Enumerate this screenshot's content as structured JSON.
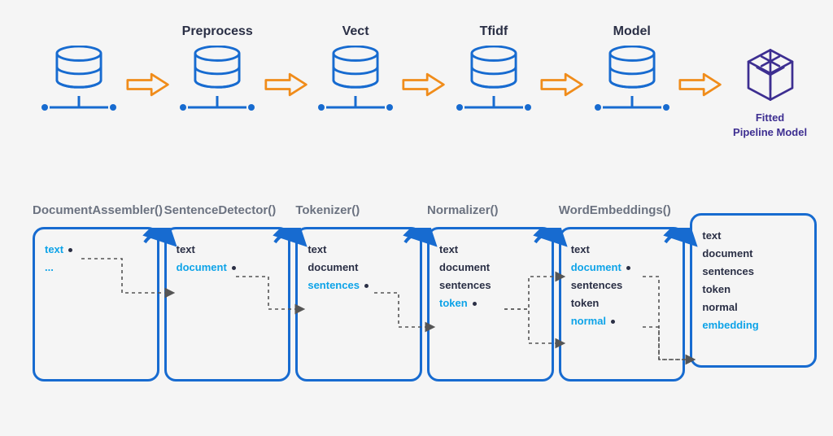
{
  "pipeline": {
    "steps": [
      "",
      "Preprocess",
      "Vect",
      "Tfidf",
      "Model"
    ],
    "final_caption_line1": "Fitted",
    "final_caption_line2": "Pipeline Model"
  },
  "stages": [
    {
      "label": "DocumentAssembler()",
      "fields": [
        {
          "text": "text",
          "blue": true,
          "dot": true
        },
        {
          "text": "...",
          "blue": true,
          "dot": false
        }
      ]
    },
    {
      "label": "SentenceDetector()",
      "fields": [
        {
          "text": "text",
          "blue": false,
          "dot": false
        },
        {
          "text": "document",
          "blue": true,
          "dot": true
        }
      ]
    },
    {
      "label": "Tokenizer()",
      "fields": [
        {
          "text": "text",
          "blue": false,
          "dot": false
        },
        {
          "text": "document",
          "blue": false,
          "dot": false
        },
        {
          "text": "sentences",
          "blue": true,
          "dot": true
        }
      ]
    },
    {
      "label": "Normalizer()",
      "fields": [
        {
          "text": "text",
          "blue": false,
          "dot": false
        },
        {
          "text": "document",
          "blue": false,
          "dot": false
        },
        {
          "text": "sentences",
          "blue": false,
          "dot": false
        },
        {
          "text": "token",
          "blue": true,
          "dot": true
        }
      ]
    },
    {
      "label": "WordEmbeddings()",
      "fields": [
        {
          "text": "text",
          "blue": false,
          "dot": false
        },
        {
          "text": "document",
          "blue": true,
          "dot": true
        },
        {
          "text": "sentences",
          "blue": false,
          "dot": false
        },
        {
          "text": "token",
          "blue": false,
          "dot": false
        },
        {
          "text": "normal",
          "blue": true,
          "dot": true
        }
      ]
    },
    {
      "label": "",
      "fields": [
        {
          "text": "text",
          "blue": false,
          "dot": false
        },
        {
          "text": "document",
          "blue": false,
          "dot": false
        },
        {
          "text": "sentences",
          "blue": false,
          "dot": false
        },
        {
          "text": "token",
          "blue": false,
          "dot": false
        },
        {
          "text": "normal",
          "blue": false,
          "dot": false
        },
        {
          "text": "embedding",
          "blue": true,
          "dot": false
        }
      ]
    }
  ]
}
